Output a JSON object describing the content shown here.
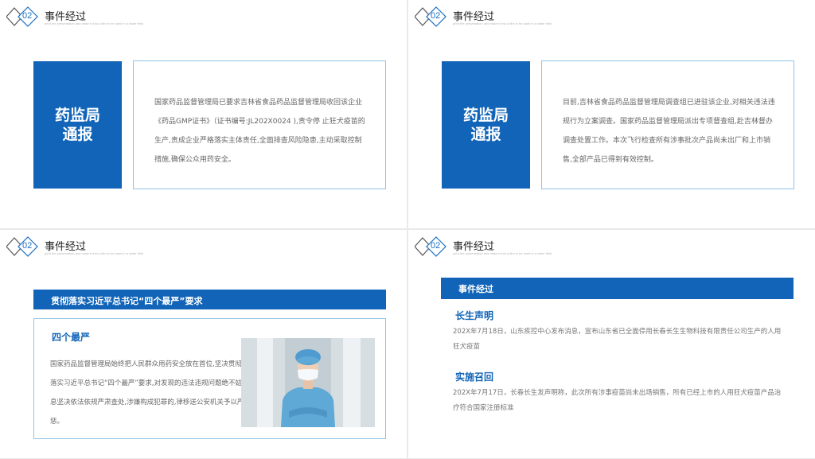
{
  "header": {
    "badge_number": "02",
    "title": "事件经过",
    "subtitle": "print the presentation and make it into a film to be used in a wider field"
  },
  "slide1": {
    "box_line1": "药监局",
    "box_line2": "通报",
    "paragraph": "国家药品监督管理局已要求吉林省食品药品监督管理局收回该企业《药品GMP证书》（证书编号:JL202X0024 ),责令停 止狂犬疫苗的生产,责成企业严格落实主体责任,全面排查风险隐患,主动采取控制措施,确保公众用药安全。"
  },
  "slide2": {
    "box_line1": "药监局",
    "box_line2": "通报",
    "paragraph": "目前,吉林省食品药品监督管理局调查组已进驻该企业,对相关违法违规行为立案调查。国家药品监督管理局派出专项督查组,赴吉林督办调查处置工作。本次飞行检查所有涉事批次产品尚未出厂和上市销售,全部产品已得到有效控制。"
  },
  "slide3": {
    "bar_title": "贯彻落实习近平总书记“四个最严”要求",
    "heading": "四个最严",
    "paragraph": "国家药品监督管理局始终把人民群众用药安全放在首位,坚决贯彻落实习近平总书记“四个最严”要求,对发现的违法违规问题绝不姑息坚决依法依规严肃查处,涉嫌构成犯罪的,律移送公安机关予以严惩。"
  },
  "slide4": {
    "bar_title": "事件经过",
    "section1_title": "长生声明",
    "section1_text": "202X年7月18日，山东疾控中心发布消息，宣布山东省已全面停用长春长生生物科技有限责任公司生产的人用狂犬疫苗",
    "section2_title": "实施召回",
    "section2_text": "202X年7月17日，长春长生发声明称，此次所有涉事疫苗尚未出场销售，所有已经上市的人用狂犬疫苗产品治疗符合国家注册标准"
  },
  "colors": {
    "accent_blue": "#1164b8",
    "border_light_blue": "#8ec3e6",
    "body_text": "#666666"
  },
  "icons": [
    "diamond-badge-icon",
    "nurse-photo"
  ]
}
